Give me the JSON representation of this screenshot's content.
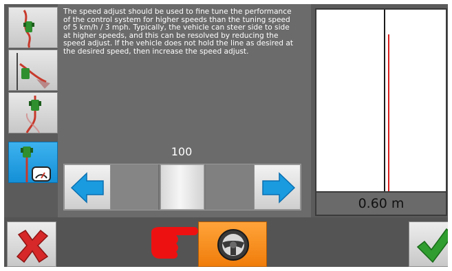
{
  "modes": [
    {
      "name": "line-tuning",
      "icon": "tractor-path-icon",
      "active": false
    },
    {
      "name": "approach-tuning",
      "icon": "tractor-approach-icon",
      "active": false
    },
    {
      "name": "online-tuning",
      "icon": "tractor-curve-icon",
      "active": false
    },
    {
      "name": "speed-adjust",
      "icon": "tractor-speedometer-icon",
      "active": true
    }
  ],
  "panel": {
    "description": "The speed adjust should be used to fine tune the performance of the control system for higher speeds than the tuning speed of 5 km/h / 3 mph. Typically, the vehicle can steer side to side at higher speeds, and this can be resolved by reducing the speed adjust. If the vehicle does not hold the line as desired at the desired speed, then increase the speed adjust.",
    "slider_value": "100",
    "slider_level": 0.5
  },
  "graph": {
    "offset_label": "0.60 m"
  },
  "buttons": {
    "cancel_icon": "red-x-icon",
    "steer_icon": "steering-wheel-icon",
    "confirm_icon": "green-checkmark-icon"
  },
  "colors": {
    "accent_blue": "#1a9be0",
    "steer_orange": "#f58a16",
    "track_red": "#d91c1c",
    "cancel_red": "#d62828",
    "confirm_green": "#2f9d2f"
  }
}
